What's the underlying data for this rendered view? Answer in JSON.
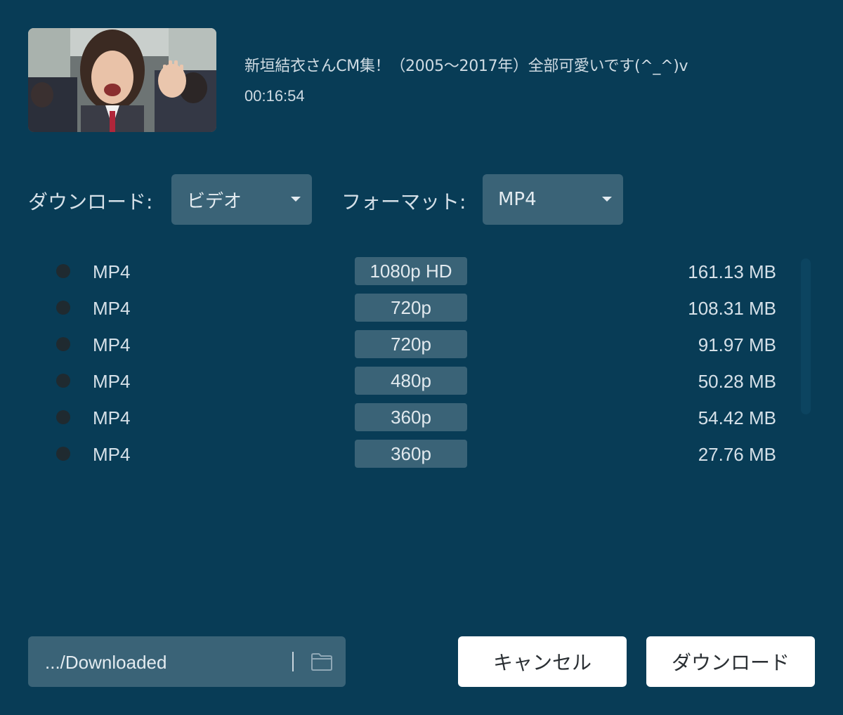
{
  "video": {
    "title": "新垣結衣さんCM集！（2005〜2017年）全部可愛いです(^_^)v",
    "duration": "00:16:54"
  },
  "controls": {
    "download_label": "ダウンロード:",
    "download_type": "ビデオ",
    "format_label": "フォーマット:",
    "format_value": "MP4"
  },
  "options": [
    {
      "format": "MP4",
      "resolution": "1080p HD",
      "size": "161.13 MB"
    },
    {
      "format": "MP4",
      "resolution": "720p",
      "size": "108.31 MB"
    },
    {
      "format": "MP4",
      "resolution": "720p",
      "size": "91.97 MB"
    },
    {
      "format": "MP4",
      "resolution": "480p",
      "size": "50.28 MB"
    },
    {
      "format": "MP4",
      "resolution": "360p",
      "size": "54.42 MB"
    },
    {
      "format": "MP4",
      "resolution": "360p",
      "size": "27.76 MB"
    }
  ],
  "footer": {
    "save_path": ".../Downloaded",
    "cancel_label": "キャンセル",
    "download_label": "ダウンロード"
  },
  "icons": {
    "folder": "folder-icon",
    "dropdown": "caret-down-icon",
    "radio": "radio-button"
  },
  "colors": {
    "background": "#083c56",
    "control": "#3a6377",
    "button": "#ffffff"
  }
}
